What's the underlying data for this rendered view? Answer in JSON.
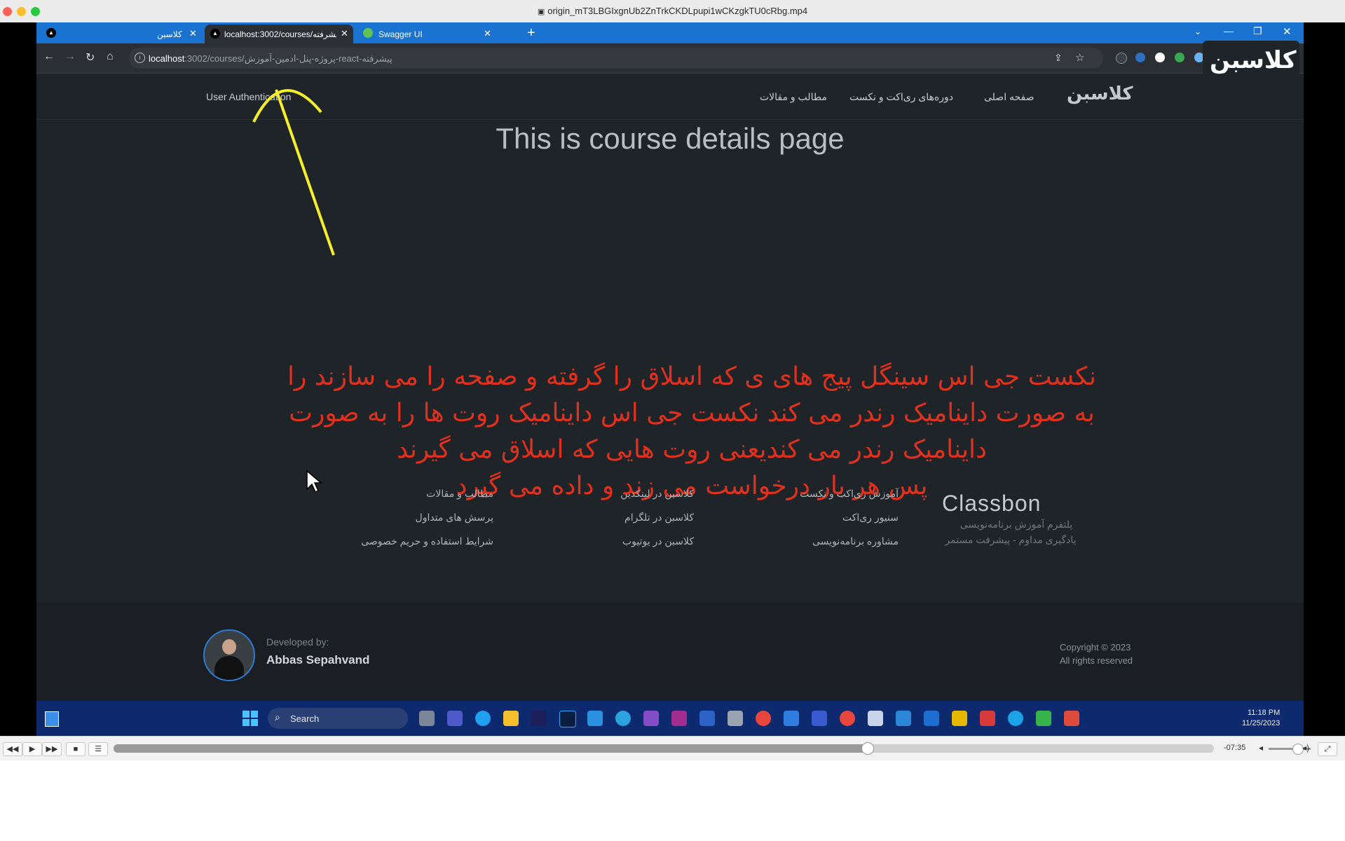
{
  "player": {
    "title": "origin_mT3LBGIxgnUb2ZnTrkCKDLpupi1wCKzgkTU0cRbg.mp4",
    "time_remaining": "-07:35",
    "progress": 0.685
  },
  "browser": {
    "tabs": [
      {
        "label": "کلاسبن"
      },
      {
        "label": "localhost:3002/courses/پیشرفته-..."
      },
      {
        "label": "Swagger UI"
      }
    ],
    "url_host": "localhost",
    "url_rest": ":3002/courses/پروژه-پنل-ادمین-آموزش-react-پیشرفته"
  },
  "site": {
    "nav": {
      "auth": "User Authentication",
      "articles": "مطالب و مقالات",
      "courses": "دوره‌های ری‌اکت و نکست",
      "home": "صفحه اصلی"
    },
    "logo_text": "کلاسبن",
    "page_title": "This is course details page",
    "annotation_lines": [
      "نکست جی اس سینگل پیج های ی که اسلاق را گرفته و صفحه را می سازند را",
      "به صورت داینامیک رندر می کند نکست جی اس داینامیک روت ها را به صورت",
      "داینامیک رندر می کندیعنی روت هایی که اسلاق می گیرند",
      "پس هر بار درخواست می زند و داده می گیرد"
    ],
    "footer": {
      "col1": [
        "آموزش ری‌اکت و نکست",
        "سنیور ری‌اکت",
        "مشاوره برنامه‌نویسی"
      ],
      "col2": [
        "کلاسبن در لینکدین",
        "کلاسبن در تلگرام",
        "کلاسبن در یوتیوب"
      ],
      "col3": [
        "مطالب و مقالات",
        "پرسش های متداول",
        "شرایط استفاده و حریم خصوصی"
      ],
      "brand_name": "Classbon",
      "brand_tag1": "پلتفرم آموزش برنامه‌نویسی",
      "brand_tag2": "یادگیری مداوم - پیشرفت مستمر"
    },
    "developer": {
      "label": "Developed by:",
      "name": "Abbas Sepahvand"
    },
    "copyright": {
      "line1": "Copyright © 2023",
      "line2": "All rights reserved"
    }
  },
  "watermark_text": "کلاسبن",
  "taskbar": {
    "search_label": "Search",
    "time": "11:18 PM",
    "date": "11/25/2023"
  }
}
